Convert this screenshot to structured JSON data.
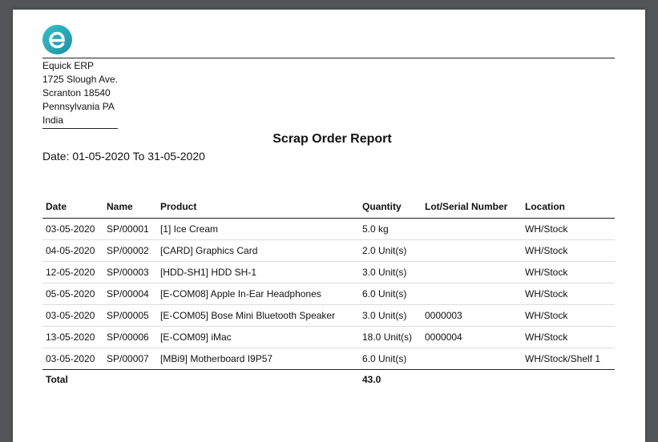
{
  "company": {
    "name": "Equick ERP",
    "address_lines": [
      "1725 Slough Ave.",
      "Scranton 18540",
      "Pennsylvania PA",
      "India"
    ],
    "logo_letter": "e",
    "logo_color": "#2aa8b8"
  },
  "report": {
    "title": "Scrap Order Report",
    "date_range": "Date: 01-05-2020 To 31-05-2020"
  },
  "table": {
    "columns": [
      "Date",
      "Name",
      "Product",
      "Quantity",
      "Lot/Serial Number",
      "Location"
    ],
    "rows": [
      {
        "date": "03-05-2020",
        "name": "SP/00001",
        "product": "[1] Ice Cream",
        "quantity": "5.0 kg",
        "lot": "",
        "location": "WH/Stock"
      },
      {
        "date": "04-05-2020",
        "name": "SP/00002",
        "product": "[CARD] Graphics Card",
        "quantity": "2.0 Unit(s)",
        "lot": "",
        "location": "WH/Stock"
      },
      {
        "date": "12-05-2020",
        "name": "SP/00003",
        "product": "[HDD-SH1] HDD SH-1",
        "quantity": "3.0 Unit(s)",
        "lot": "",
        "location": "WH/Stock"
      },
      {
        "date": "05-05-2020",
        "name": "SP/00004",
        "product": "[E-COM08] Apple In-Ear Headphones",
        "quantity": "6.0 Unit(s)",
        "lot": "",
        "location": "WH/Stock"
      },
      {
        "date": "03-05-2020",
        "name": "SP/00005",
        "product": "[E-COM05] Bose Mini Bluetooth Speaker",
        "quantity": "3.0 Unit(s)",
        "lot": "0000003",
        "location": "WH/Stock"
      },
      {
        "date": "13-05-2020",
        "name": "SP/00006",
        "product": "[E-COM09] iMac",
        "quantity": "18.0 Unit(s)",
        "lot": "0000004",
        "location": "WH/Stock"
      },
      {
        "date": "03-05-2020",
        "name": "SP/00007",
        "product": "[MBi9] Motherboard I9P57",
        "quantity": "6.0 Unit(s)",
        "lot": "",
        "location": "WH/Stock/Shelf 1"
      }
    ],
    "total_label": "Total",
    "total_quantity": "43.0"
  }
}
